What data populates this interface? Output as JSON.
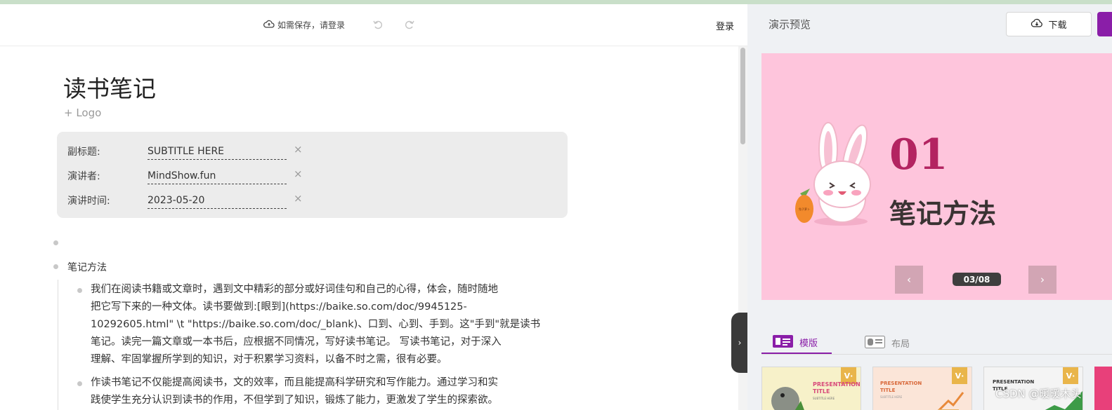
{
  "toolbar": {
    "save_hint": "如需保存，请登录",
    "login": "登录"
  },
  "doc": {
    "title": "读书笔记",
    "add_logo": "+ Logo",
    "meta": [
      {
        "label": "副标题:",
        "value": "SUBTITLE HERE"
      },
      {
        "label": "演讲者:",
        "value": "MindShow.fun"
      },
      {
        "label": "演讲时间:",
        "value": "2023-05-20"
      }
    ],
    "clear_symbol": "×",
    "outline_heading": "笔记方法",
    "paragraphs": [
      {
        "lines": [
          "我们在阅读书籍或文章时，遇到文中精彩的部分或好词佳句和自己的心得，体会，随时随地",
          "把它写下来的一种文体。读书要做到:[眼到](https://baike.so.com/doc/9945125-",
          "10292605.html\" \\t \"https://baike.so.com/doc/_blank)、口到、心到、手到。这\"手到\"就是读书",
          "笔记。读完一篇文章或一本书后，应根据不同情况，写好读书笔记。 写读书笔记，对于深入",
          "理解、牢固掌握所学到的知识，对于积累学习资料，以备不时之需，很有必要。"
        ]
      },
      {
        "lines": [
          "作读书笔记不仅能提高阅读书，文的效率，而且能提高科学研究和写作能力。通过学习和实",
          "践使学生充分认识到读书的作用，不但学到了知识，锻炼了能力，更激发了学生的探索欲。"
        ]
      }
    ]
  },
  "preview": {
    "title": "演示预览",
    "download_label": "下载",
    "slide": {
      "number": "01",
      "heading": "笔记方法",
      "bg_color": "#fec5dc",
      "number_color": "#b32461",
      "carrot_label": "兔子萝卜"
    },
    "page_indicator": "03/08",
    "tabs": {
      "template": "模版",
      "layout": "布局"
    },
    "thumbnails": [
      {
        "title": "PRESENTATION TITLE",
        "subtitle": "SUBTITLE HERE",
        "badge": "V·"
      },
      {
        "title": "PRESENTATION TITLE",
        "subtitle": "SUBTITLE HERE",
        "badge": "V·"
      },
      {
        "title": "PRESENTATION TITLE",
        "subtitle": "",
        "badge": "V·"
      }
    ]
  },
  "watermark": "CSDN @暖暖木头",
  "colors": {
    "accent": "#8a1ea8",
    "preview_bg": "#eff1f4"
  }
}
